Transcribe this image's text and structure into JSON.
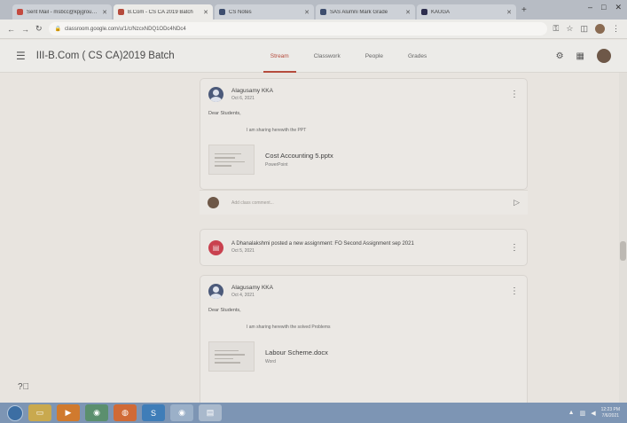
{
  "browser": {
    "tabs": [
      {
        "label": "Sent Mail - msbcc@kpjgroup.edu",
        "favicon_color": "#c44a3f",
        "active": false
      },
      {
        "label": "B.Com - CS CA 2019 Batch",
        "favicon_color": "#b54b3c",
        "active": true
      },
      {
        "label": "CS Notes",
        "favicon_color": "#3e4e6e",
        "active": false
      },
      {
        "label": "SAS Alumni Mark Grade",
        "favicon_color": "#3e4e6e",
        "active": false
      },
      {
        "label": "KAUGA",
        "favicon_color": "#2e2e4e",
        "active": false
      }
    ],
    "new_tab": "+",
    "window_controls": {
      "minimize": "–",
      "maximize": "□",
      "close": "✕"
    },
    "url": "classroom.google.com/u/1/c/NzcxNDQ1ODc4NDc4"
  },
  "classroom": {
    "class_title": "III-B.Com ( CS CA)2019 Batch",
    "tabs": [
      {
        "label": "Stream",
        "active": true
      },
      {
        "label": "Classwork",
        "active": false
      },
      {
        "label": "People",
        "active": false
      },
      {
        "label": "Grades",
        "active": false
      }
    ]
  },
  "stream": {
    "posts": [
      {
        "author": "Alagusamy KKA",
        "date": "Oct 6, 2021",
        "greeting": "Dear Students,",
        "body": "I am sharing herewith the PPT",
        "attachment": {
          "name": "Cost Accounting 5.pptx",
          "type": "PowerPoint"
        }
      },
      {
        "author": "Alagusamy KKA",
        "date": "Oct 4, 2021",
        "greeting": "Dear Students,",
        "body": "I am sharing herewith the solved Problems",
        "attachment": {
          "name": "Labour Scheme.docx",
          "type": "Word"
        }
      }
    ],
    "comment_placeholder": "Add class comment...",
    "assignment": {
      "title": "A Dhanalakshmi posted a new assignment: FO Second Assignment sep 2021",
      "date": "Oct 5, 2021"
    }
  },
  "taskbar": {
    "clock_time": "12:23 PM",
    "clock_date": "7/6/2021"
  }
}
